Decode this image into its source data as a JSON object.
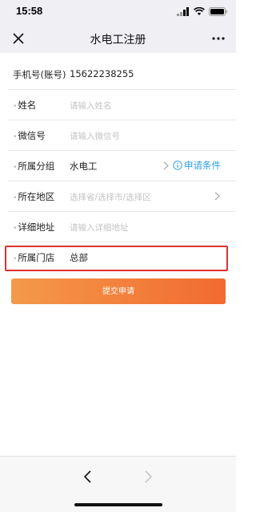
{
  "status": {
    "time": "15:58"
  },
  "nav": {
    "title": "水电工注册"
  },
  "form": {
    "phone": {
      "label": "手机号(账号)",
      "value": "15622238255"
    },
    "name": {
      "label": "姓名",
      "placeholder": "请输入姓名"
    },
    "wechat": {
      "label": "微信号",
      "placeholder": "请输入微信号"
    },
    "group": {
      "label": "所属分组",
      "value": "水电工",
      "apply_link": "申请条件"
    },
    "region": {
      "label": "所在地区",
      "placeholder": "选择省/选择市/选择区"
    },
    "address": {
      "label": "详细地址",
      "placeholder": "请输入详细地址"
    },
    "store": {
      "label": "所属门店",
      "value": "总部"
    }
  },
  "submit_label": "提交申请",
  "colors": {
    "accent_start": "#f39a4a",
    "accent_end": "#f26a30",
    "link": "#2ea0e6",
    "highlight": "#e03030"
  }
}
